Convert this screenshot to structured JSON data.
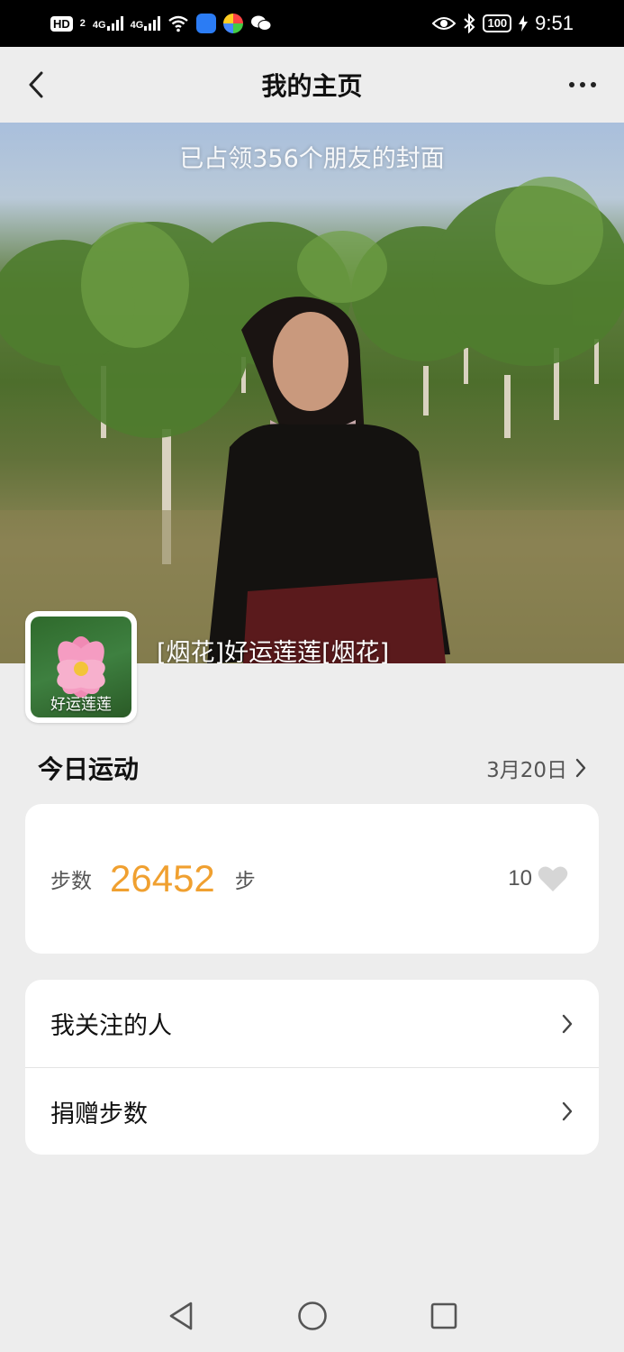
{
  "status_bar": {
    "hd": "HD",
    "sim": "2",
    "net1": "4G",
    "net2": "4G",
    "battery": "100",
    "time": "9:51"
  },
  "header": {
    "title": "我的主页"
  },
  "cover": {
    "caption": "已占领356个朋友的封面",
    "nickname": "[烟花]好运莲莲[烟花]"
  },
  "avatar": {
    "caption": "好运莲莲"
  },
  "today": {
    "title": "今日运动",
    "date": "3月20日",
    "steps_label": "步数",
    "steps_value": "26452",
    "steps_unit": "步",
    "likes": "10"
  },
  "menu": {
    "items": [
      {
        "label": "我关注的人"
      },
      {
        "label": "捐赠步数"
      }
    ]
  },
  "colors": {
    "accent": "#f0a030",
    "background": "#ededed"
  }
}
